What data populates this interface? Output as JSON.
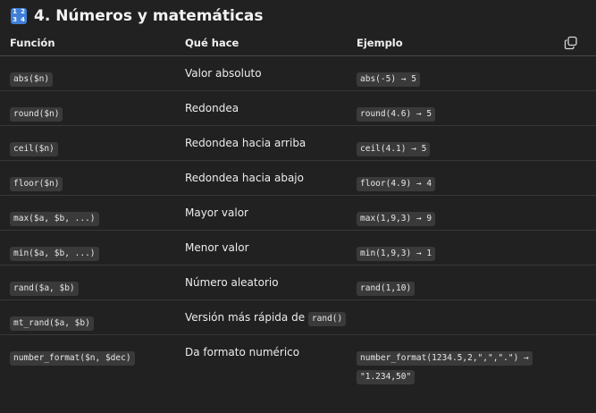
{
  "heading": {
    "emoji_label": "1234",
    "title": "4. Números y matemáticas"
  },
  "table": {
    "columns": [
      "Función",
      "Qué hace",
      "Ejemplo"
    ],
    "copy_icon": "copy-icon",
    "rows": [
      {
        "func": "abs($n)",
        "desc": "Valor absoluto",
        "example": "abs(-5) → 5"
      },
      {
        "func": "round($n)",
        "desc": "Redondea",
        "example": "round(4.6) → 5"
      },
      {
        "func": "ceil($n)",
        "desc": "Redondea hacia arriba",
        "example": "ceil(4.1) → 5"
      },
      {
        "func": "floor($n)",
        "desc": "Redondea hacia abajo",
        "example": "floor(4.9) → 4"
      },
      {
        "func": "max($a, $b, ...)",
        "desc": "Mayor valor",
        "example": "max(1,9,3) → 9"
      },
      {
        "func": "min($a, $b, ...)",
        "desc": "Menor valor",
        "example": "min(1,9,3) → 1"
      },
      {
        "func": "rand($a, $b)",
        "desc": "Número aleatorio",
        "example": "rand(1,10)"
      },
      {
        "func": "mt_rand($a, $b)",
        "desc": "Versión más rápida de",
        "desc_code": "rand()",
        "example": ""
      },
      {
        "func": "number_format($n, $dec)",
        "desc": "Da formato numérico",
        "example": "number_format(1234.5,2,\",\",\".\") →",
        "example_line2": "\"1.234,50\""
      }
    ]
  }
}
